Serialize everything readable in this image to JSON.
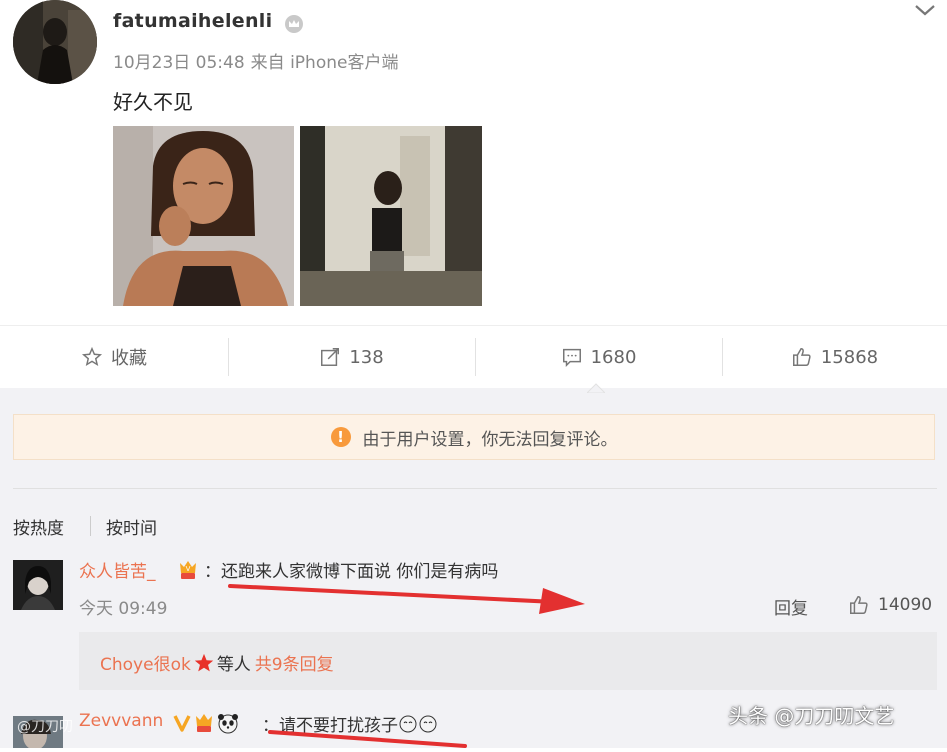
{
  "post": {
    "username": "fatumaihelenli",
    "date": "10月23日 05:48",
    "source": "来自 iPhone客户端",
    "text": "好久不见"
  },
  "actions": {
    "favorite_label": "收藏",
    "repost_count": "138",
    "comment_count": "1680",
    "like_count": "15868"
  },
  "notice": {
    "icon": "!",
    "text": "由于用户设置，你无法回复评论。"
  },
  "sort": {
    "by_hot": "按热度",
    "by_time": "按时间"
  },
  "comments": [
    {
      "username": "众人皆苦_",
      "separator": "：",
      "text": "还跑来人家微博下面说 你们是有病吗",
      "time": "今天 09:49",
      "reply_label": "回复",
      "like_count": "14090"
    },
    {
      "username": "Zevvvann",
      "separator": "：",
      "text": "请不要打扰孩子"
    }
  ],
  "reply_summary": {
    "user": "Choye很ok",
    "others": "等人",
    "count_text": "共9条回复"
  },
  "watermark": {
    "text": "头条 @刀刀叨文艺",
    "small": "@刀刀叨"
  },
  "colors": {
    "accent": "#eb7350",
    "notice_bg": "#fdf2e6",
    "arrow": "#e33030"
  }
}
